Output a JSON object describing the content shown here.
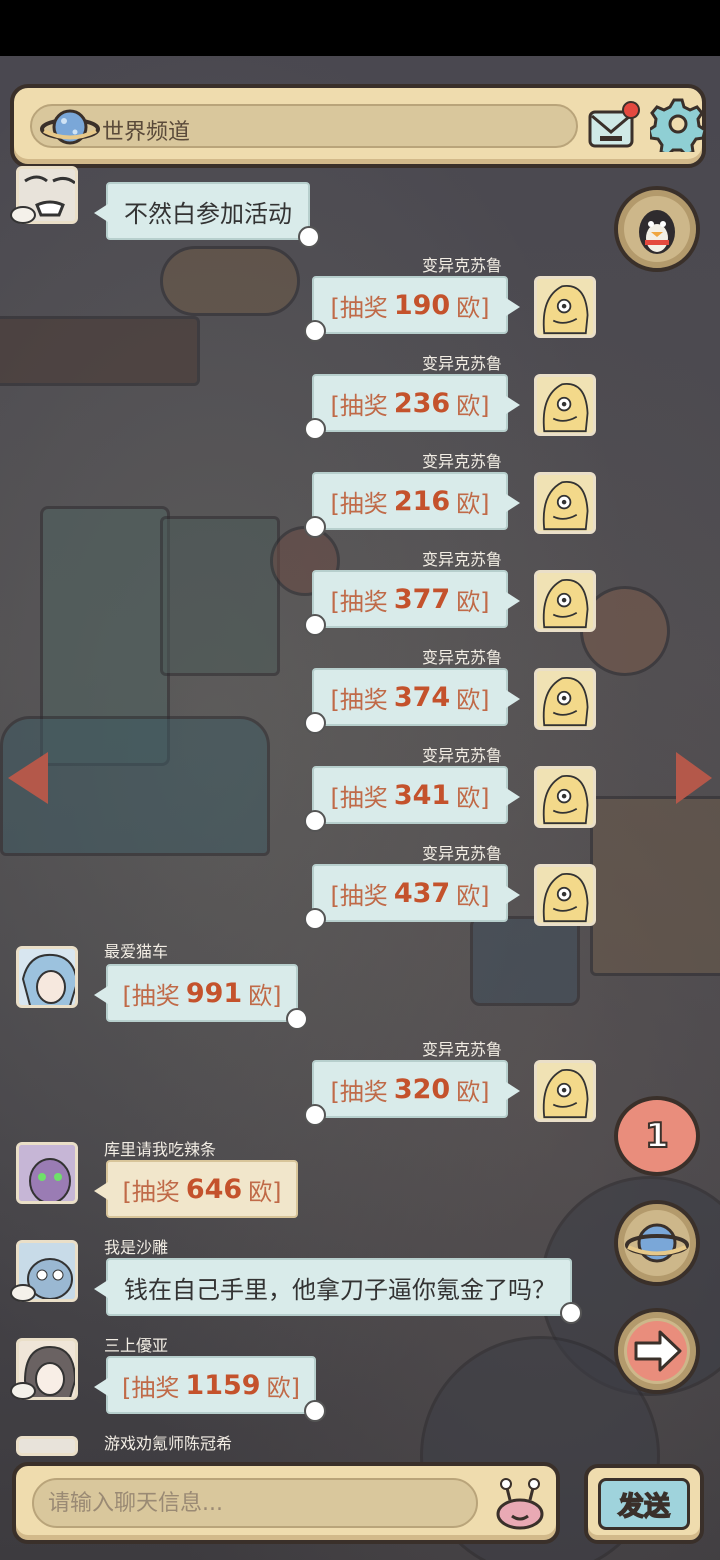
{
  "channel": {
    "name": "世界频道"
  },
  "colors": {
    "bubble": "#d9ebea",
    "gold_bubble": "#f1e6cb",
    "accent": "#c4522c",
    "frame": "#efdcae"
  },
  "messages": [
    {
      "side": "left",
      "name": "",
      "type": "text",
      "text": "不然白参加活动",
      "avatar": "grumpy-face-avatar"
    },
    {
      "side": "right",
      "name": "变异克苏鲁",
      "type": "lottery",
      "prefix": "[抽奖",
      "amount": "190",
      "suffix": "欧]"
    },
    {
      "side": "right",
      "name": "变异克苏鲁",
      "type": "lottery",
      "prefix": "[抽奖",
      "amount": "236",
      "suffix": "欧]"
    },
    {
      "side": "right",
      "name": "变异克苏鲁",
      "type": "lottery",
      "prefix": "[抽奖",
      "amount": "216",
      "suffix": "欧]"
    },
    {
      "side": "right",
      "name": "变异克苏鲁",
      "type": "lottery",
      "prefix": "[抽奖",
      "amount": "377",
      "suffix": "欧]"
    },
    {
      "side": "right",
      "name": "变异克苏鲁",
      "type": "lottery",
      "prefix": "[抽奖",
      "amount": "374",
      "suffix": "欧]"
    },
    {
      "side": "right",
      "name": "变异克苏鲁",
      "type": "lottery",
      "prefix": "[抽奖",
      "amount": "341",
      "suffix": "欧]"
    },
    {
      "side": "right",
      "name": "变异克苏鲁",
      "type": "lottery",
      "prefix": "[抽奖",
      "amount": "437",
      "suffix": "欧]"
    },
    {
      "side": "left",
      "name": "最爱猫车",
      "type": "lottery",
      "prefix": "[抽奖",
      "amount": "991",
      "suffix": "欧]"
    },
    {
      "side": "right",
      "name": "变异克苏鲁",
      "type": "lottery",
      "prefix": "[抽奖",
      "amount": "320",
      "suffix": "欧]"
    },
    {
      "side": "left",
      "name": "库里请我吃辣条",
      "type": "lottery",
      "prefix": "[抽奖",
      "amount": "646",
      "suffix": "欧]"
    },
    {
      "side": "left",
      "name": "我是沙雕",
      "type": "text",
      "text": "钱在自己手里，他拿刀子逼你氪金了吗？"
    },
    {
      "side": "left",
      "name": "三上優亚",
      "type": "lottery",
      "prefix": "[抽奖",
      "amount": "1159",
      "suffix": "欧]"
    },
    {
      "side": "left",
      "name": "游戏劝氪师陈冠希"
    }
  ],
  "unread_count": "1",
  "input": {
    "placeholder": "请输入聊天信息..."
  },
  "send": {
    "label": "发送"
  }
}
